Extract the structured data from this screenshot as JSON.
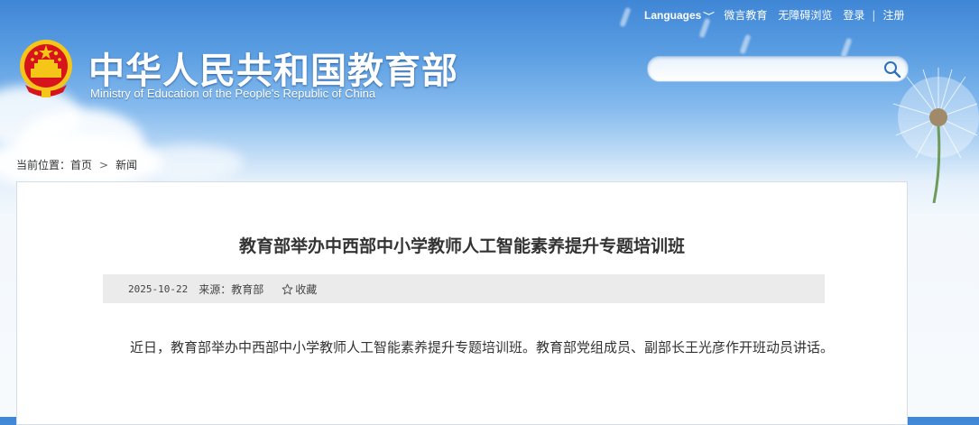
{
  "topnav": {
    "languages": "Languages",
    "links": [
      "微言教育",
      "无障碍浏览",
      "登录",
      "注册"
    ]
  },
  "header": {
    "title_cn": "中华人民共和国教育部",
    "title_en": "Ministry of Education of the People's Republic of China"
  },
  "search": {
    "placeholder": "",
    "value": ""
  },
  "breadcrumb": {
    "label": "当前位置：",
    "home": "首页",
    "current": "新闻"
  },
  "article": {
    "title": "教育部举办中西部中小学教师人工智能素养提升专题培训班",
    "date": "2025-10-22",
    "source": "来源：教育部",
    "favorite": "收藏",
    "body": "近日，教育部举办中西部中小学教师人工智能素养提升专题培训班。教育部党组成员、副部长王光彦作开班动员讲话。"
  },
  "colors": {
    "header_blue": "#3f86d6",
    "emblem_red": "#d7131c",
    "emblem_gold": "#f5c518",
    "meta_bg": "#ebebeb"
  },
  "icons": [
    "chevron-down-icon",
    "search-icon",
    "star-icon",
    "national-emblem-icon"
  ]
}
